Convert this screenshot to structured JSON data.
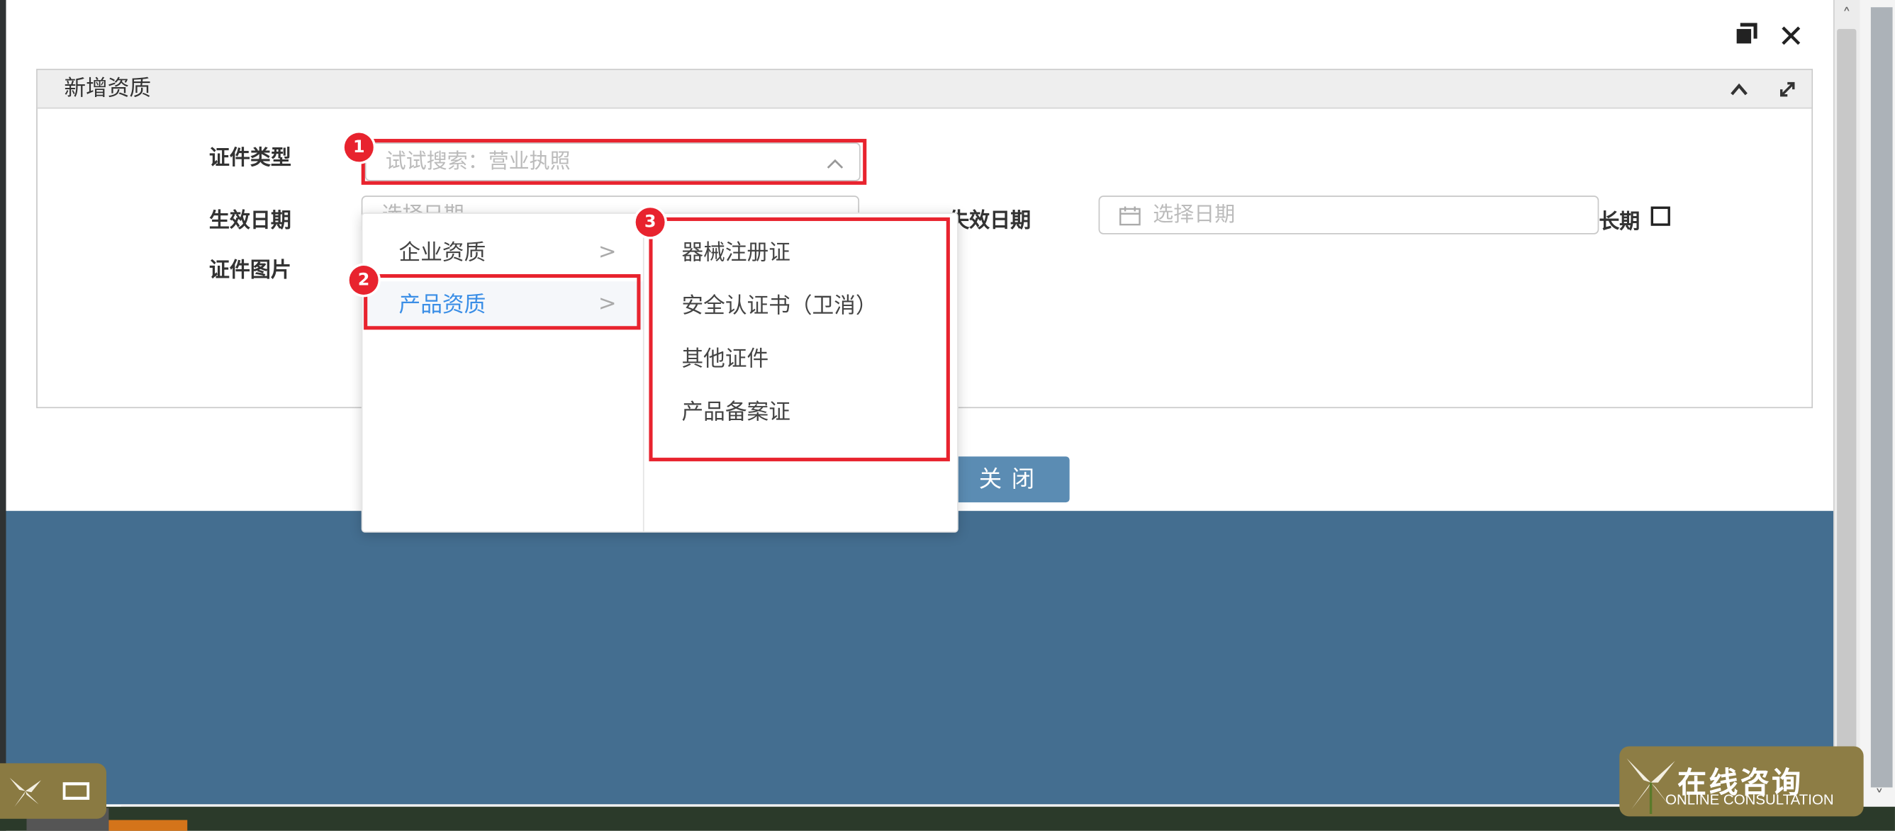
{
  "dialog": {
    "restore_label": "restore-icon",
    "close_symbol": "✕"
  },
  "panel": {
    "title": "新增资质",
    "collapse_symbol": "︿",
    "expand_symbol": "⤢"
  },
  "form": {
    "cert_type_label": "证件类型",
    "cert_type_placeholder": "试试搜索：营业执照",
    "effective_date_label": "生效日期",
    "effective_date_placeholder": "选择日期",
    "expiry_date_label": "失效日期",
    "expiry_date_placeholder": "选择日期",
    "long_term_label": "长期",
    "cert_image_label": "证件图片",
    "close_button": "关闭"
  },
  "cascader": {
    "level1": [
      {
        "label": "企业资质",
        "active": false
      },
      {
        "label": "产品资质",
        "active": true
      }
    ],
    "level2": [
      "器械注册证",
      "安全认证书（卫消）",
      "其他证件",
      "产品备案证"
    ]
  },
  "annotations": {
    "badge1": "1",
    "badge2": "2",
    "badge3": "3"
  },
  "widget": {
    "title": "在线咨询",
    "subtitle": "ONLINE CONSULTATION"
  },
  "colors": {
    "highlight": "#e8232e",
    "accent_blue": "#5b8cb3",
    "backdrop": "#446e90",
    "active_text": "#3a8ee6"
  }
}
